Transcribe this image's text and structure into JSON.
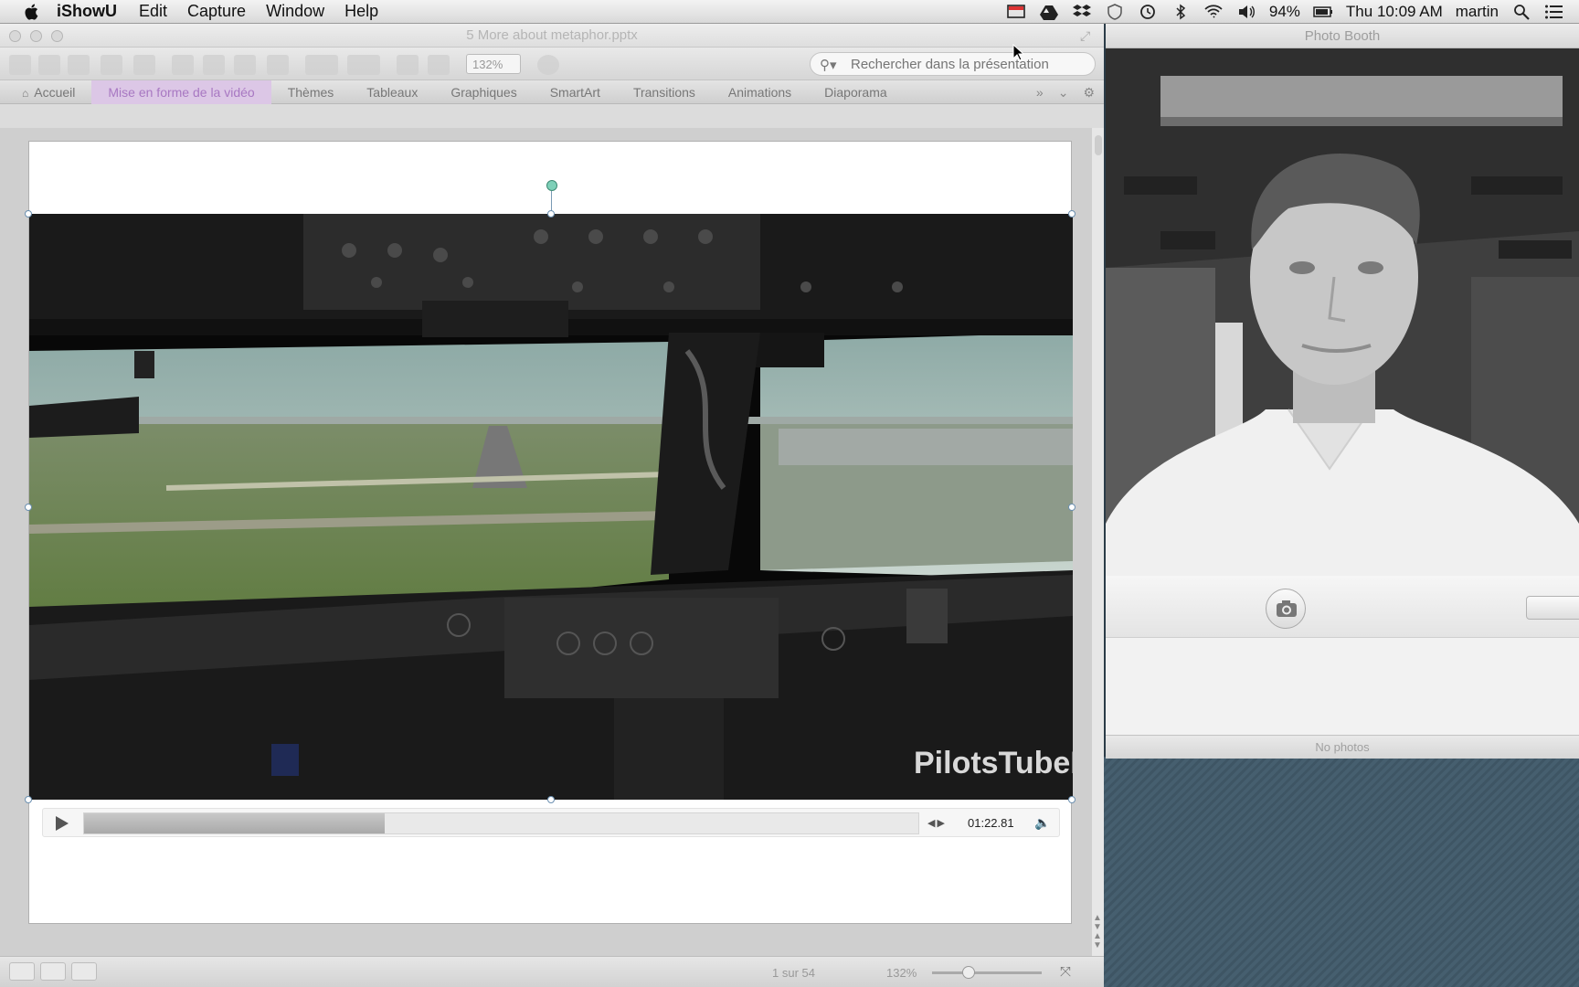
{
  "menubar": {
    "app_name": "iShowU",
    "menus": [
      "Edit",
      "Capture",
      "Window",
      "Help"
    ],
    "battery": "94%",
    "clock": "Thu 10:09 AM",
    "user": "martin",
    "icons": [
      "display-icon",
      "google-drive-icon",
      "dropbox-icon",
      "shield-icon",
      "time-machine-icon",
      "bluetooth-icon",
      "wifi-icon",
      "volume-icon",
      "battery-icon",
      "spotlight-icon",
      "notification-list-icon"
    ]
  },
  "powerpoint": {
    "window_title": "5 More about metaphor.pptx",
    "zoom_value": "132%",
    "search_placeholder": "Rechercher dans la présentation",
    "ribbon_tabs": [
      {
        "label": "Accueil"
      },
      {
        "label": "Mise en forme de la vidéo",
        "active": true
      },
      {
        "label": "Thèmes"
      },
      {
        "label": "Tableaux"
      },
      {
        "label": "Graphiques"
      },
      {
        "label": "SmartArt"
      },
      {
        "label": "Transitions"
      },
      {
        "label": "Animations"
      },
      {
        "label": "Diaporama"
      }
    ],
    "video": {
      "watermark": "PilotsTubeHD",
      "time": "01:22.81",
      "progress": 0.36
    },
    "status": {
      "page": "1 sur 54",
      "zoom": "132%"
    }
  },
  "photobooth": {
    "title": "Photo Booth",
    "footer": "No photos"
  },
  "colors": {
    "active_tab_bg": "#dcc7e6",
    "active_tab_text": "#a878c2",
    "desktop": "#3e5564"
  }
}
